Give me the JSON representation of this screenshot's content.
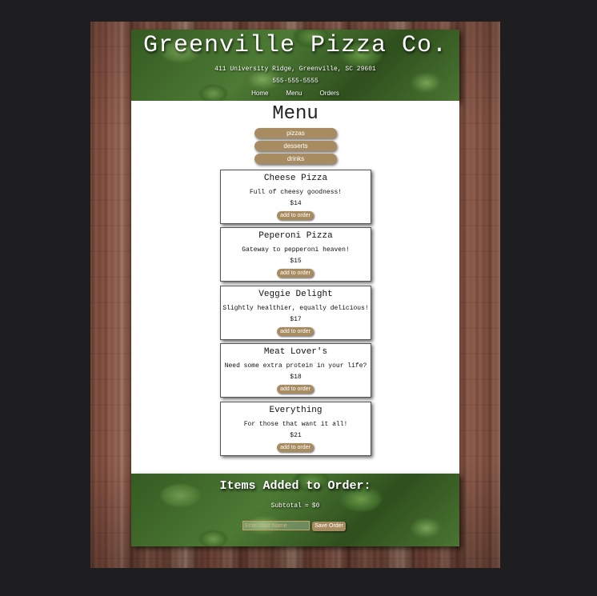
{
  "header": {
    "title": "Greenville Pizza Co.",
    "address": "411 University Ridge, Greenville, SC 29601",
    "phone": "555-555-5555",
    "nav": [
      "Home",
      "Menu",
      "Orders"
    ]
  },
  "main": {
    "title": "Menu",
    "categories": [
      "pizzas",
      "desserts",
      "drinks"
    ],
    "items": [
      {
        "name": "Cheese Pizza",
        "description": "Full of cheesy goodness!",
        "price": "$14",
        "button": "add to order"
      },
      {
        "name": "Peperoni Pizza",
        "description": "Gateway to pepperoni heaven!",
        "price": "$15",
        "button": "add to order"
      },
      {
        "name": "Veggie Delight",
        "description": "Slightly healthier, equally delicious!",
        "price": "$17",
        "button": "add to order"
      },
      {
        "name": "Meat Lover's",
        "description": "Need some extra protein in your life?",
        "price": "$18",
        "button": "add to order"
      },
      {
        "name": "Everything",
        "description": "For those that want it all!",
        "price": "$21",
        "button": "add to order"
      }
    ]
  },
  "order": {
    "heading": "Items Added to Order:",
    "subtotal_label": "Subtotal",
    "subtotal_equals": "=",
    "subtotal_value": "$0",
    "last_name_placeholder": "Enter Last Name",
    "save_label": "Save Order"
  },
  "colors": {
    "button": "#a88c61",
    "page_background": "#1e1e20",
    "content_background": "#ffffff"
  }
}
